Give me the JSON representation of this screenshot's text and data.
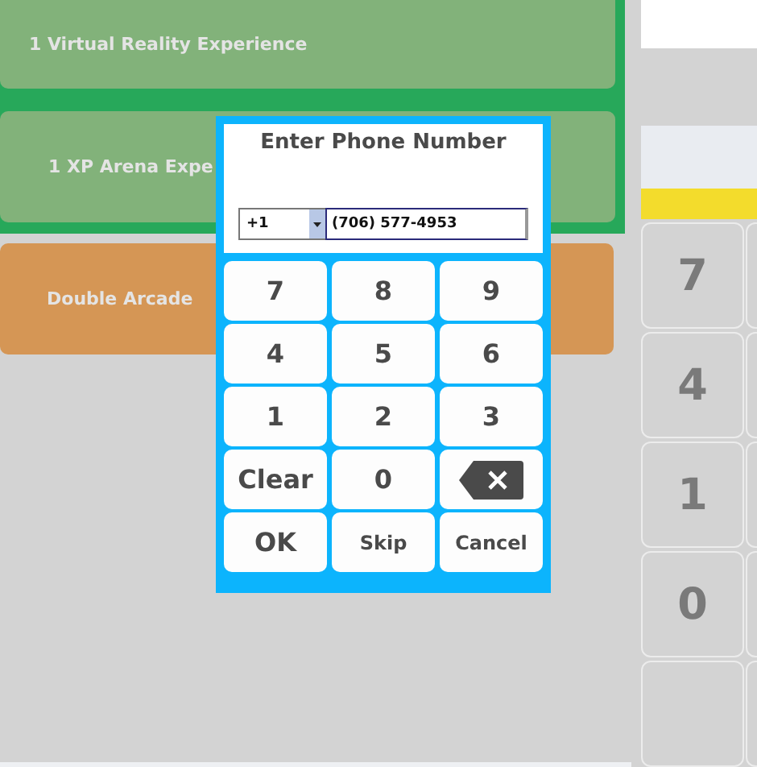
{
  "tiles": [
    {
      "label": "1 Virtual Reality Experience",
      "kind": "green"
    },
    {
      "label": "1 XP Arena Expe",
      "kind": "green"
    },
    {
      "label": "Double Arcade",
      "kind": "orange"
    }
  ],
  "side_keypad": {
    "keys": [
      "7",
      "4",
      "1",
      "0"
    ]
  },
  "dialog": {
    "title": "Enter Phone Number",
    "country_code": "+1",
    "phone": "(706) 577-4953",
    "keys": [
      {
        "label": "7",
        "kind": "digit"
      },
      {
        "label": "8",
        "kind": "digit"
      },
      {
        "label": "9",
        "kind": "digit"
      },
      {
        "label": "4",
        "kind": "digit"
      },
      {
        "label": "5",
        "kind": "digit"
      },
      {
        "label": "6",
        "kind": "digit"
      },
      {
        "label": "1",
        "kind": "digit"
      },
      {
        "label": "2",
        "kind": "digit"
      },
      {
        "label": "3",
        "kind": "digit"
      },
      {
        "label": "Clear",
        "kind": "digit"
      },
      {
        "label": "0",
        "kind": "digit"
      },
      {
        "kind": "backspace"
      },
      {
        "label": "OK",
        "kind": "digit"
      },
      {
        "label": "Skip",
        "kind": "small"
      },
      {
        "label": "Cancel",
        "kind": "small"
      }
    ]
  }
}
